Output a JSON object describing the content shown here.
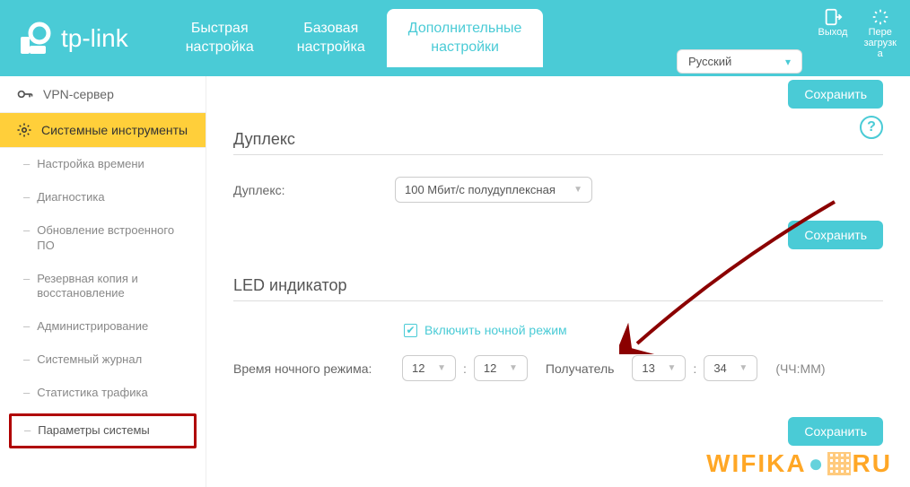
{
  "brand": "tp-link",
  "header": {
    "tabs": [
      {
        "line1": "Быстрая",
        "line2": "настройка"
      },
      {
        "line1": "Базовая",
        "line2": "настройка"
      },
      {
        "line1": "Дополнительные",
        "line2": "настройки"
      }
    ],
    "logout": "Выход",
    "reload_l1": "Пере",
    "reload_l2": "загрузк",
    "reload_l3": "а",
    "language": "Русский"
  },
  "sidebar": {
    "vpn": "VPN-сервер",
    "systools": "Системные инструменты",
    "items": [
      "Настройка времени",
      "Диагностика",
      "Обновление встроенного ПО",
      "Резервная копия и восстановление",
      "Администрирование",
      "Системный журнал",
      "Статистика трафика",
      "Параметры системы"
    ]
  },
  "content": {
    "save": "Сохранить",
    "duplex_title": "Дуплекс",
    "duplex_label": "Дуплекс:",
    "duplex_value": "100 Мбит/с полудуплексная",
    "led_title": "LED индикатор",
    "night_mode_label": "Включить ночной режим",
    "night_time_label": "Время ночного режима:",
    "from_h": "12",
    "from_m": "12",
    "recipient": "Получатель",
    "to_h": "13",
    "to_m": "34",
    "format": "(ЧЧ:ММ)"
  },
  "watermark": {
    "left": "WIFIKA",
    "right": "RU"
  },
  "colors": {
    "accent": "#4acbd6",
    "warn": "#ffcf3a",
    "arrow": "#8b0000"
  }
}
